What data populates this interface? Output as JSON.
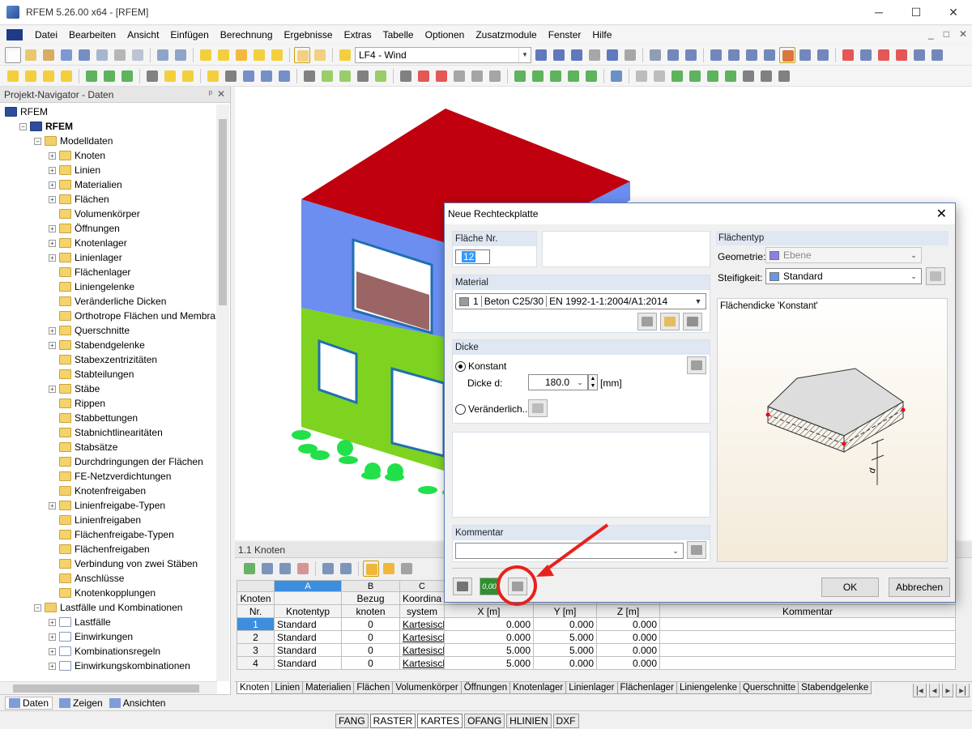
{
  "window": {
    "title": "RFEM 5.26.00 x64 - [RFEM]",
    "controls": [
      "─",
      "☐",
      "✕"
    ]
  },
  "menu": {
    "items": [
      "Datei",
      "Bearbeiten",
      "Ansicht",
      "Einfügen",
      "Berechnung",
      "Ergebnisse",
      "Extras",
      "Tabelle",
      "Optionen",
      "Zusatzmodule",
      "Fenster",
      "Hilfe"
    ],
    "mdi_controls": [
      "_",
      "□",
      "✕"
    ]
  },
  "toolbar": {
    "loadcase": "LF4 - Wind"
  },
  "navigator": {
    "title": "Projekt-Navigator - Daten",
    "pin": "ᵖ",
    "close": "✕",
    "tree": [
      {
        "label": "RFEM",
        "level": 0,
        "icon": "root",
        "exp": "",
        "bold": false
      },
      {
        "label": "RFEM",
        "level": 1,
        "icon": "root",
        "exp": "⊟",
        "bold": true
      },
      {
        "label": "Modelldaten",
        "level": 2,
        "icon": "folder",
        "exp": "⊟",
        "bold": false
      },
      {
        "label": "Knoten",
        "level": 3,
        "icon": "item",
        "exp": "+",
        "bold": false
      },
      {
        "label": "Linien",
        "level": 3,
        "icon": "item",
        "exp": "+",
        "bold": false
      },
      {
        "label": "Materialien",
        "level": 3,
        "icon": "item",
        "exp": "+",
        "bold": false
      },
      {
        "label": "Flächen",
        "level": 3,
        "icon": "item",
        "exp": "+",
        "bold": false
      },
      {
        "label": "Volumenkörper",
        "level": 3,
        "icon": "item",
        "exp": "",
        "bold": false
      },
      {
        "label": "Öffnungen",
        "level": 3,
        "icon": "item",
        "exp": "+",
        "bold": false
      },
      {
        "label": "Knotenlager",
        "level": 3,
        "icon": "item",
        "exp": "+",
        "bold": false
      },
      {
        "label": "Linienlager",
        "level": 3,
        "icon": "item",
        "exp": "+",
        "bold": false
      },
      {
        "label": "Flächenlager",
        "level": 3,
        "icon": "item",
        "exp": "",
        "bold": false
      },
      {
        "label": "Liniengelenke",
        "level": 3,
        "icon": "item",
        "exp": "",
        "bold": false
      },
      {
        "label": "Veränderliche Dicken",
        "level": 3,
        "icon": "item",
        "exp": "",
        "bold": false
      },
      {
        "label": "Orthotrope Flächen und Membrar",
        "level": 3,
        "icon": "item",
        "exp": "",
        "bold": false
      },
      {
        "label": "Querschnitte",
        "level": 3,
        "icon": "item",
        "exp": "+",
        "bold": false
      },
      {
        "label": "Stabendgelenke",
        "level": 3,
        "icon": "item",
        "exp": "+",
        "bold": false
      },
      {
        "label": "Stabexzentrizitäten",
        "level": 3,
        "icon": "item",
        "exp": "",
        "bold": false
      },
      {
        "label": "Stabteilungen",
        "level": 3,
        "icon": "item",
        "exp": "",
        "bold": false
      },
      {
        "label": "Stäbe",
        "level": 3,
        "icon": "item",
        "exp": "+",
        "bold": false
      },
      {
        "label": "Rippen",
        "level": 3,
        "icon": "item",
        "exp": "",
        "bold": false
      },
      {
        "label": "Stabbettungen",
        "level": 3,
        "icon": "item",
        "exp": "",
        "bold": false
      },
      {
        "label": "Stabnichtlinearitäten",
        "level": 3,
        "icon": "item",
        "exp": "",
        "bold": false
      },
      {
        "label": "Stabsätze",
        "level": 3,
        "icon": "item",
        "exp": "",
        "bold": false
      },
      {
        "label": "Durchdringungen der Flächen",
        "level": 3,
        "icon": "item",
        "exp": "",
        "bold": false
      },
      {
        "label": "FE-Netzverdichtungen",
        "level": 3,
        "icon": "item",
        "exp": "",
        "bold": false
      },
      {
        "label": "Knotenfreigaben",
        "level": 3,
        "icon": "folder",
        "exp": "",
        "bold": false
      },
      {
        "label": "Linienfreigabe-Typen",
        "level": 3,
        "icon": "item",
        "exp": "+",
        "bold": false
      },
      {
        "label": "Linienfreigaben",
        "level": 3,
        "icon": "folder",
        "exp": "",
        "bold": false
      },
      {
        "label": "Flächenfreigabe-Typen",
        "level": 3,
        "icon": "item",
        "exp": "",
        "bold": false
      },
      {
        "label": "Flächenfreigaben",
        "level": 3,
        "icon": "item",
        "exp": "",
        "bold": false
      },
      {
        "label": "Verbindung von zwei Stäben",
        "level": 3,
        "icon": "item",
        "exp": "",
        "bold": false
      },
      {
        "label": "Anschlüsse",
        "level": 3,
        "icon": "folder",
        "exp": "",
        "bold": false
      },
      {
        "label": "Knotenkopplungen",
        "level": 3,
        "icon": "item",
        "exp": "",
        "bold": false
      },
      {
        "label": "Lastfälle und Kombinationen",
        "level": 2,
        "icon": "folder",
        "exp": "⊟",
        "bold": false
      },
      {
        "label": "Lastfälle",
        "level": 3,
        "icon": "page",
        "exp": "+",
        "bold": false
      },
      {
        "label": "Einwirkungen",
        "level": 3,
        "icon": "page",
        "exp": "+",
        "bold": false
      },
      {
        "label": "Kombinationsregeln",
        "level": 3,
        "icon": "page",
        "exp": "+",
        "bold": false
      },
      {
        "label": "Einwirkungskombinationen",
        "level": 3,
        "icon": "page",
        "exp": "+",
        "bold": false
      }
    ],
    "tabs": [
      "Daten",
      "Zeigen",
      "Ansichten"
    ]
  },
  "table": {
    "title": "1.1 Knoten",
    "col_letters": [
      "A",
      "B",
      "C",
      "",
      "",
      "",
      ""
    ],
    "col_headers": [
      [
        "Knoten",
        "Nr."
      ],
      [
        "",
        "Knotentyp"
      ],
      [
        "Bezug",
        "knoten"
      ],
      [
        "Koordina",
        "system"
      ],
      [
        "",
        "X [m]"
      ],
      [
        "",
        "Y [m]"
      ],
      [
        "",
        "Z [m]"
      ],
      [
        "",
        "Kommentar"
      ]
    ],
    "rows": [
      {
        "nr": "1",
        "typ": "Standard",
        "bezug": "0",
        "sys": "Kartesisch",
        "x": "0.000",
        "y": "0.000",
        "z": "0.000",
        "kommentar": ""
      },
      {
        "nr": "2",
        "typ": "Standard",
        "bezug": "0",
        "sys": "Kartesisch",
        "x": "0.000",
        "y": "5.000",
        "z": "0.000",
        "kommentar": ""
      },
      {
        "nr": "3",
        "typ": "Standard",
        "bezug": "0",
        "sys": "Kartesisch",
        "x": "5.000",
        "y": "5.000",
        "z": "0.000",
        "kommentar": ""
      },
      {
        "nr": "4",
        "typ": "Standard",
        "bezug": "0",
        "sys": "Kartesisch",
        "x": "5.000",
        "y": "0.000",
        "z": "0.000",
        "kommentar": ""
      }
    ],
    "sheet_tabs": [
      "Knoten",
      "Linien",
      "Materialien",
      "Flächen",
      "Volumenkörper",
      "Öffnungen",
      "Knotenlager",
      "Linienlager",
      "Flächenlager",
      "Liniengelenke",
      "Querschnitte",
      "Stabendgelenke"
    ],
    "tab_nav": [
      "|◂",
      "◂",
      "▸",
      "▸|"
    ]
  },
  "statusbar": {
    "buttons": [
      "FANG",
      "RASTER",
      "KARTES",
      "OFANG",
      "HLINIEN",
      "DXF"
    ]
  },
  "dialog": {
    "title": "Neue Rechteckplatte",
    "close": "✕",
    "flaeche_nr_label": "Fläche Nr.",
    "flaeche_nr_value": "12",
    "material_label": "Material",
    "material_nr": "1",
    "material_name": "Beton C25/30",
    "material_norm": "EN 1992-1-1:2004/A1:2014",
    "dicke_label": "Dicke",
    "konstant_label": "Konstant",
    "dicke_d_label": "Dicke d:",
    "dicke_value": "180.0",
    "dicke_unit": "[mm]",
    "veraenderlich_label": "Veränderlich...",
    "kommentar_label": "Kommentar",
    "kommentar_value": "",
    "flaechentyp_label": "Flächentyp",
    "geometrie_label": "Geometrie:",
    "geometrie_value": "Ebene",
    "steifigkeit_label": "Steifigkeit:",
    "steifigkeit_value": "Standard",
    "preview_caption": "Flächendicke 'Konstant'",
    "preview_dim": "d",
    "ok_label": "OK",
    "cancel_label": "Abbrechen",
    "units_btn_text": "0,00",
    "geometrie_color": "#8b80e6",
    "steifigkeit_color": "#6a96e8",
    "material_color": "#9a9a9a"
  },
  "colors": {
    "roof": "#c0000e",
    "upper_floor": "#6b8ef0",
    "lower_floor": "#7ed321",
    "supports": "#22e04a",
    "highlight_circle": "#e8211c",
    "title_bar": "#2c64a8"
  }
}
